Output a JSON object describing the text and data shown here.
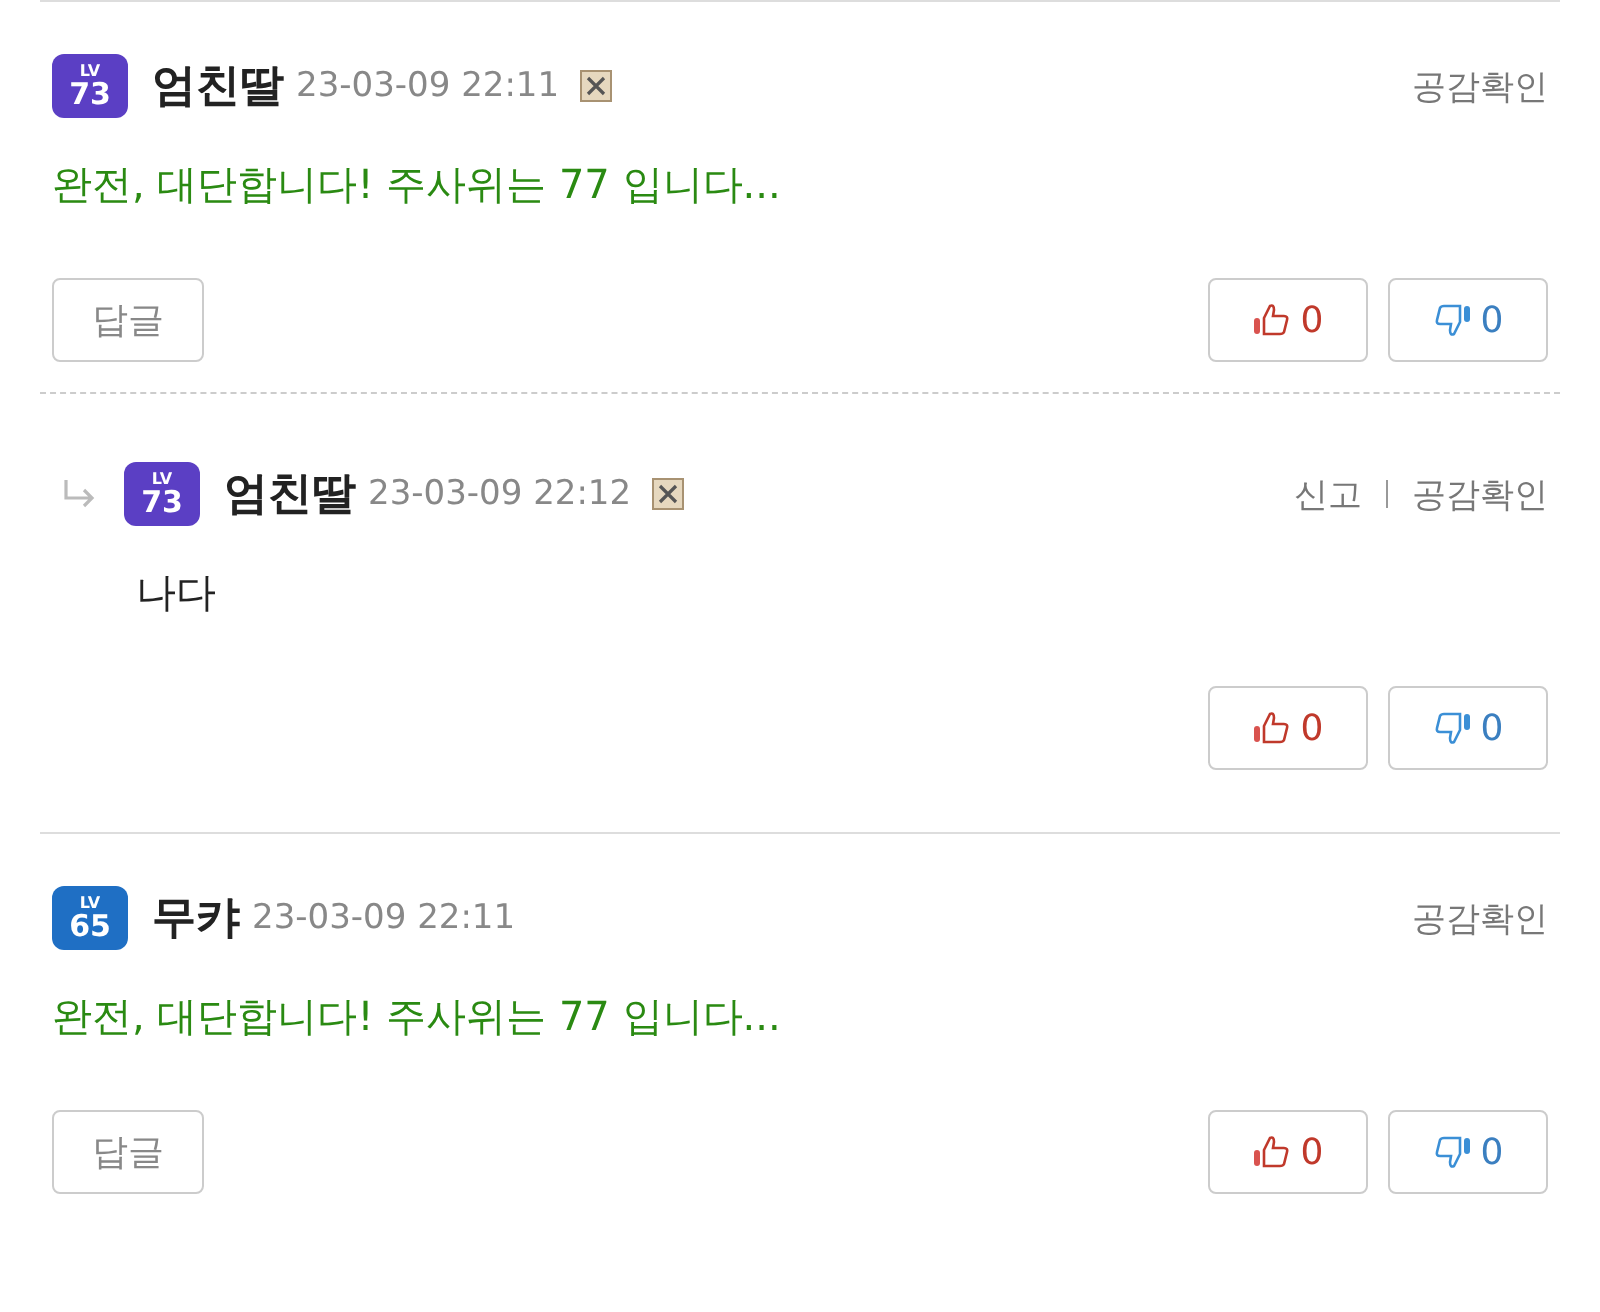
{
  "comments": [
    {
      "kind": "comment",
      "badge": {
        "label": "LV",
        "number": "73",
        "color": "#5b3fc4"
      },
      "author": "엄친딸",
      "time": "23-03-09 22:11",
      "broken_image": true,
      "actions": [
        "공감확인"
      ],
      "body": "완전, 대단합니다!  주사위는 77 입니다...",
      "highlight": true,
      "reply_button": "답글",
      "likes": "0",
      "dislikes": "0"
    },
    {
      "kind": "reply",
      "badge": {
        "label": "LV",
        "number": "73",
        "color": "#5b3fc4"
      },
      "author": "엄친딸",
      "time": "23-03-09 22:12",
      "broken_image": true,
      "actions": [
        "신고",
        "공감확인"
      ],
      "body": "나다",
      "highlight": false,
      "likes": "0",
      "dislikes": "0"
    },
    {
      "kind": "comment",
      "badge": {
        "label": "LV",
        "number": "65",
        "color": "#1f6fc4"
      },
      "author": "무캬",
      "time": "23-03-09 22:11",
      "actions": [
        "공감확인"
      ],
      "body": "완전, 대단합니다!  주사위는 77 입니다...",
      "highlight": true,
      "reply_button": "답글",
      "likes": "0",
      "dislikes": "0"
    }
  ]
}
